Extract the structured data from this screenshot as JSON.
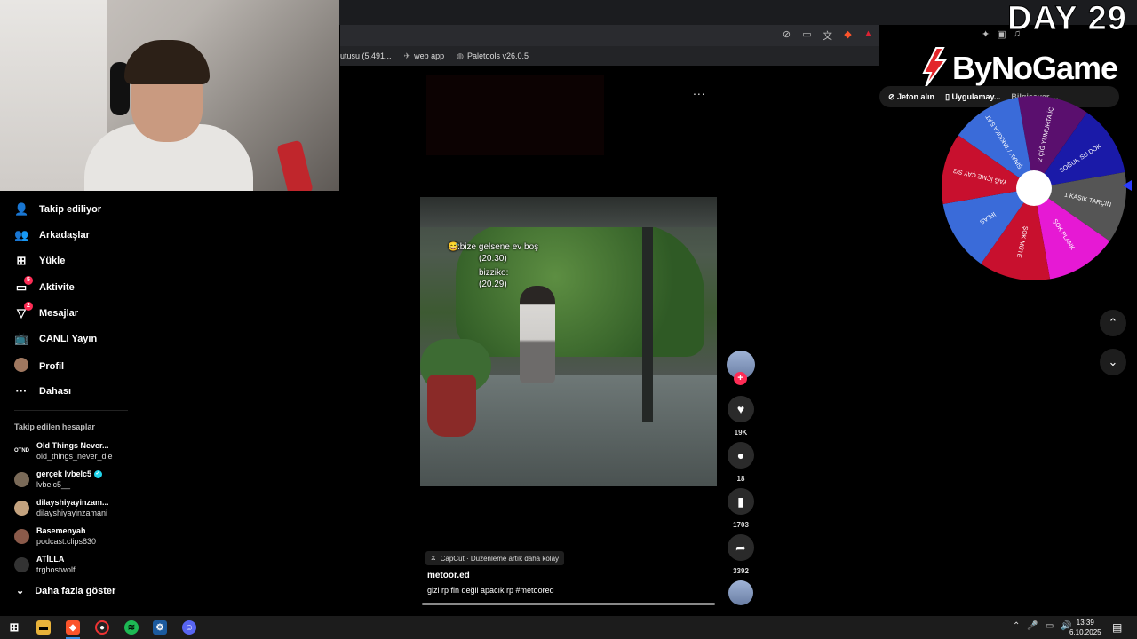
{
  "overlay": {
    "day_label": "DAY 29",
    "brand": "ByNoGame"
  },
  "browser": {
    "bookmarks": [
      {
        "label": "utusu (5.491...",
        "icon": "bookmark-icon"
      },
      {
        "label": "web app",
        "icon": "globe-icon"
      },
      {
        "label": "Paletools v26.0.5",
        "icon": "palette-icon"
      }
    ]
  },
  "sidebar": {
    "nav": [
      {
        "label": "Takip ediliyor",
        "icon": "following-icon",
        "badge": ""
      },
      {
        "label": "Arkadaşlar",
        "icon": "friends-icon",
        "badge": ""
      },
      {
        "label": "Yükle",
        "icon": "upload-icon",
        "badge": ""
      },
      {
        "label": "Aktivite",
        "icon": "activity-icon",
        "badge": "5"
      },
      {
        "label": "Mesajlar",
        "icon": "messages-icon",
        "badge": "2"
      },
      {
        "label": "CANLI Yayın",
        "icon": "live-icon",
        "badge": ""
      },
      {
        "label": "Profil",
        "icon": "avatar",
        "badge": ""
      },
      {
        "label": "Dahası",
        "icon": "more-icon",
        "badge": ""
      }
    ],
    "following_title": "Takip edilen hesaplar",
    "accounts": [
      {
        "name": "Old Things Never...",
        "username": "old_things_never_die",
        "verified": false,
        "avatar_text": "OTND"
      },
      {
        "name": "gerçek lvbelc5",
        "username": "lvbelc5__",
        "verified": true,
        "avatar_text": ""
      },
      {
        "name": "dilayshiyayinzam...",
        "username": "dilayshiyayinzamani",
        "verified": false,
        "avatar_text": ""
      },
      {
        "name": "Basemenyah",
        "username": "podcast.clips830",
        "verified": false,
        "avatar_text": ""
      },
      {
        "name": "ATİLLA",
        "username": "trghostwolf",
        "verified": false,
        "avatar_text": ""
      }
    ],
    "show_more": "Daha fazla göster"
  },
  "header_right": {
    "coins": "Jeton alın",
    "app": "Uygulamay...",
    "extra": "Bilgisayar ..."
  },
  "wheel": {
    "segments": [
      {
        "label": "2 ÇİĞ YUMURTA İÇ",
        "color": "#5a0f6e"
      },
      {
        "label": "SOĞUK SU DÖK",
        "color": "#1a1aa8"
      },
      {
        "label": "1 KAŞIK TARÇIN",
        "color": "#555555"
      },
      {
        "label": "ŞOK PLANK",
        "color": "#e619d4"
      },
      {
        "label": "ŞOK MÜTE",
        "color": "#c8102e"
      },
      {
        "label": "İFLAS",
        "color": "#3a6bd9"
      },
      {
        "label": "YAĞ İÇME ÇAY S/2",
        "color": "#c8102e"
      },
      {
        "label": "ŞINAV / TAKKIKA 5 AT",
        "color": "#3a6bd9"
      }
    ]
  },
  "video": {
    "overlay_lines": [
      ":bize gelsene ev boş",
      "(20.30)",
      "bizziko:",
      "(20.29)"
    ],
    "emoji": "😅",
    "menu": "..."
  },
  "actions": {
    "likes": "19K",
    "comments": "18",
    "saves": "1703",
    "shares": "3392"
  },
  "caption": {
    "capcut": "CapCut · Düzenleme artık daha kolay",
    "author": "metoor.ed",
    "description": "glzi rp fln değil apacık rp #metoored",
    "progress": 1.0
  },
  "taskbar": {
    "time": "13:39",
    "date": "6.10.2025"
  }
}
